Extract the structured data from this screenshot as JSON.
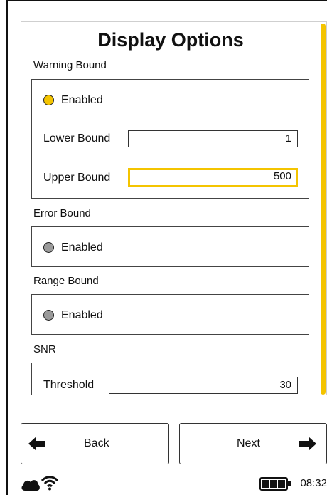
{
  "page": {
    "title": "Display Options"
  },
  "warning_bound": {
    "section_label": "Warning Bound",
    "enabled_label": "Enabled",
    "enabled": true,
    "lower_label": "Lower Bound",
    "lower_value": "1",
    "upper_label": "Upper Bound",
    "upper_value": "500"
  },
  "error_bound": {
    "section_label": "Error Bound",
    "enabled_label": "Enabled",
    "enabled": false
  },
  "range_bound": {
    "section_label": "Range Bound",
    "enabled_label": "Enabled",
    "enabled": false
  },
  "snr": {
    "section_label": "SNR",
    "threshold_label": "Threshold",
    "threshold_value": "30"
  },
  "nav": {
    "back_label": "Back",
    "next_label": "Next"
  },
  "status": {
    "time": "08:32",
    "icons": [
      "cloud-icon",
      "wifi-icon",
      "battery-icon"
    ],
    "battery_level": 1.0
  },
  "colors": {
    "accent": "#f4c400",
    "disabled_radio": "#9a9a9a",
    "border": "#333333"
  }
}
